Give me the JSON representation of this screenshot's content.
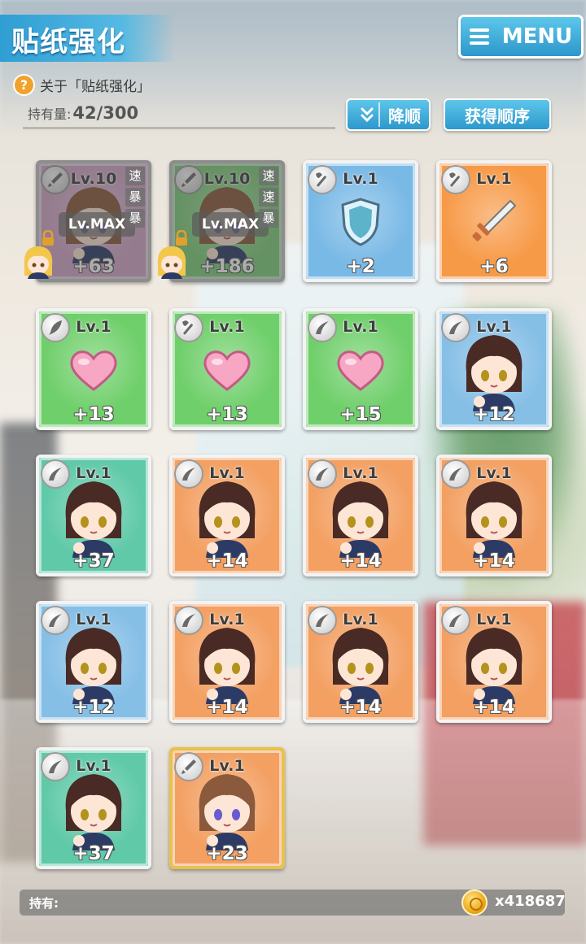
{
  "header": {
    "title": "贴纸强化",
    "menu_label": "MENU"
  },
  "help": {
    "icon": "?",
    "text": "关于「贴纸强化」"
  },
  "holdings": {
    "label": "持有量:",
    "value": "42/300"
  },
  "sort": {
    "order_label": "降顺",
    "mode_label": "获得顺序"
  },
  "footer": {
    "label": "持有:",
    "currency": "x418687"
  },
  "stickers": [
    {
      "level": "Lv.10",
      "plus": "+63",
      "max": "Lv.MAX",
      "tags": [
        "速",
        "暴",
        "暴"
      ],
      "type": "dagger",
      "art": "girl-brown",
      "bg": "#d4a6c8",
      "owned": true
    },
    {
      "level": "Lv.10",
      "plus": "+186",
      "max": "Lv.MAX",
      "tags": [
        "速",
        "速",
        "暴"
      ],
      "type": "dagger",
      "art": "girl-brown",
      "bg": "#7fd07a",
      "owned": true
    },
    {
      "level": "Lv.1",
      "plus": "+2",
      "type": "axe",
      "art": "shield",
      "bg": "#79b9e6"
    },
    {
      "level": "Lv.1",
      "plus": "+6",
      "type": "axe",
      "art": "sword",
      "bg": "#f79a48"
    },
    {
      "level": "Lv.1",
      "plus": "+13",
      "type": "feather",
      "art": "heart",
      "bg": "#6fcf6a"
    },
    {
      "level": "Lv.1",
      "plus": "+13",
      "type": "axe",
      "art": "heart",
      "bg": "#6fcf6a"
    },
    {
      "level": "Lv.1",
      "plus": "+15",
      "type": "boomerang",
      "art": "heart",
      "bg": "#6fcf6a"
    },
    {
      "level": "Lv.1",
      "plus": "+12",
      "type": "boomerang",
      "art": "girl-dark",
      "bg": "#86bfe6"
    },
    {
      "level": "Lv.1",
      "plus": "+37",
      "type": "boomerang",
      "art": "girl-dark",
      "bg": "#5fc9a8"
    },
    {
      "level": "Lv.1",
      "plus": "+14",
      "type": "boomerang",
      "art": "girl-dark",
      "bg": "#f3a062"
    },
    {
      "level": "Lv.1",
      "plus": "+14",
      "type": "boomerang",
      "art": "girl-dark",
      "bg": "#f3a062"
    },
    {
      "level": "Lv.1",
      "plus": "+14",
      "type": "boomerang",
      "art": "girl-dark",
      "bg": "#f3a062"
    },
    {
      "level": "Lv.1",
      "plus": "+12",
      "type": "boomerang",
      "art": "girl-dark",
      "bg": "#86bfe6"
    },
    {
      "level": "Lv.1",
      "plus": "+14",
      "type": "boomerang",
      "art": "girl-dark",
      "bg": "#f3a062"
    },
    {
      "level": "Lv.1",
      "plus": "+14",
      "type": "boomerang",
      "art": "girl-dark",
      "bg": "#f3a062"
    },
    {
      "level": "Lv.1",
      "plus": "+14",
      "type": "boomerang",
      "art": "girl-dark",
      "bg": "#f3a062"
    },
    {
      "level": "Lv.1",
      "plus": "+37",
      "type": "boomerang",
      "art": "girl-dark",
      "bg": "#5fc9a8"
    },
    {
      "level": "Lv.1",
      "plus": "+23",
      "type": "dagger",
      "art": "girl-brown",
      "bg": "#f3a062",
      "gold": true
    }
  ]
}
